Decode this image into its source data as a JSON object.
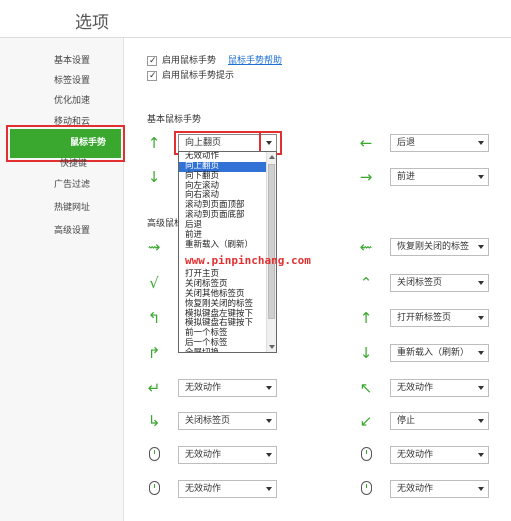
{
  "window": {
    "title": "选项"
  },
  "sidebar": {
    "items": [
      {
        "label": "基本设置"
      },
      {
        "label": "标签设置"
      },
      {
        "label": "优化加速"
      },
      {
        "label": "移动和云"
      },
      {
        "label": "鼠标手势"
      },
      {
        "label": "快捷键"
      },
      {
        "label": "广告过滤"
      },
      {
        "label": "热键网址"
      },
      {
        "label": "高级设置"
      }
    ],
    "active_index": 4
  },
  "options": {
    "enable_gesture": "启用鼠标手势",
    "gesture_help": "鼠标手势帮助",
    "enable_gesture_tip": "启用鼠标手势提示"
  },
  "basic": {
    "heading": "基本鼠标手势",
    "up": "向上翻页",
    "left": "后退",
    "right": "前进"
  },
  "advanced": {
    "heading_partial": "高级鼠标",
    "rows": [
      {
        "left": "",
        "right": "恢复刚关闭的标签"
      },
      {
        "left": "",
        "right": "关闭标签页"
      },
      {
        "left": "",
        "right": "打开新标签页"
      },
      {
        "left": "",
        "right": "重新载入（刷新）"
      },
      {
        "left": "无效动作",
        "right": "无效动作"
      },
      {
        "left": "关闭标签页",
        "right": "停止"
      },
      {
        "left": "无效动作",
        "right": "无效动作"
      },
      {
        "left": "无效动作",
        "right": "无效动作"
      }
    ]
  },
  "dropdown": {
    "items": [
      "无效动作",
      "向上翻页",
      "向下翻页",
      "向左滚动",
      "向右滚动",
      "滚动到页面顶部",
      "滚动到页面底部",
      "后退",
      "前进",
      "重新载入（刷新）",
      "",
      "",
      "打开主页",
      "关闭标签页",
      "关闭其他标签页",
      "恢复刚关闭的标签",
      "模拟键盘左键按下",
      "模拟键盘右键按下",
      "前一个标签",
      "后一个标签",
      "全屏切换"
    ],
    "selected_index": 1
  },
  "watermark": "www.pinpinchang.com",
  "colors": {
    "accent": "#3aa82f",
    "highlight": "#e23030",
    "selection": "#3271d6",
    "link": "#1d6fd3"
  }
}
